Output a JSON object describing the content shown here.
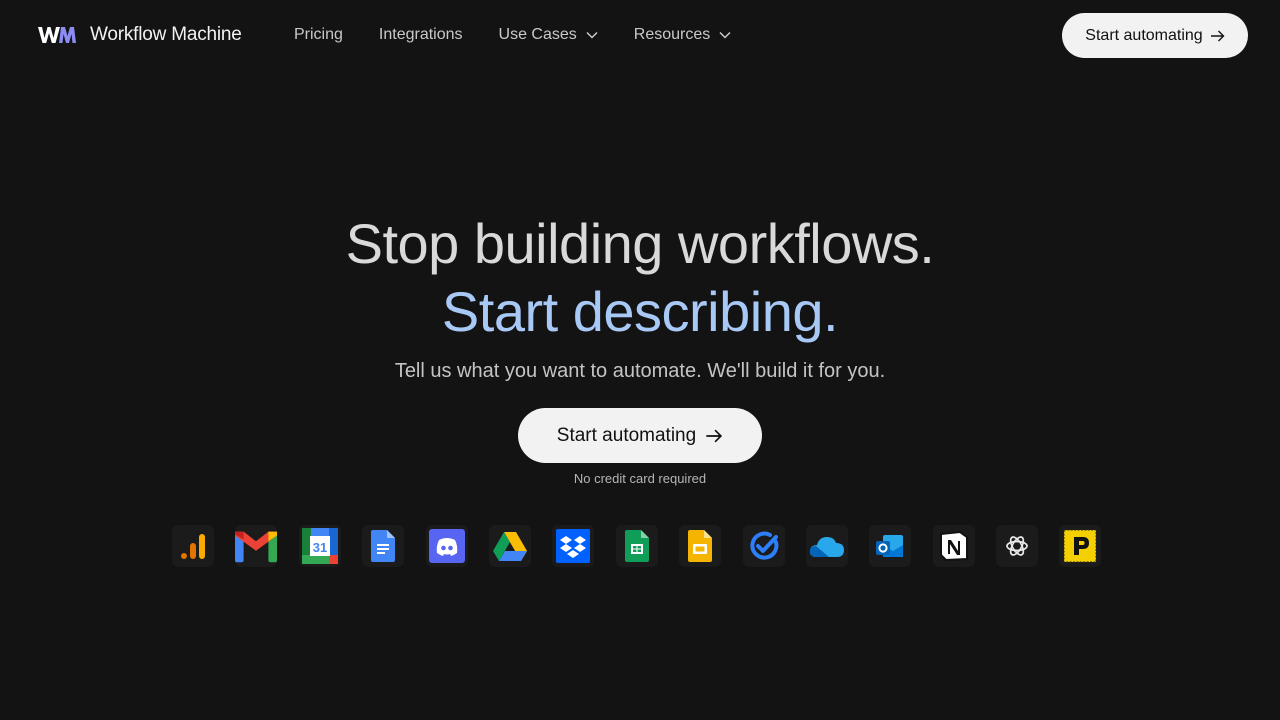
{
  "brand": {
    "name": "Workflow Machine",
    "logo_icon": "wm-logo-icon"
  },
  "nav": {
    "links": [
      {
        "label": "Pricing",
        "has_dropdown": false
      },
      {
        "label": "Integrations",
        "has_dropdown": false
      },
      {
        "label": "Use Cases",
        "has_dropdown": true
      },
      {
        "label": "Resources",
        "has_dropdown": true
      }
    ],
    "cta_label": "Start automating"
  },
  "hero": {
    "title_line1": "Stop building workflows.",
    "title_line2": "Start describing.",
    "subtitle": "Tell us what you want to automate. We'll build it for you.",
    "cta_label": "Start automating",
    "note": "No credit card required"
  },
  "integrations": [
    "google-analytics-icon",
    "gmail-icon",
    "google-calendar-icon",
    "google-docs-icon",
    "discord-icon",
    "google-drive-icon",
    "dropbox-icon",
    "google-sheets-icon",
    "google-slides-icon",
    "check-circle-icon",
    "onedrive-icon",
    "outlook-icon",
    "notion-icon",
    "openai-icon",
    "producthunt-icon"
  ],
  "calendar_day": "31",
  "colors": {
    "background": "#131313",
    "accent_title": "#a8c8f5",
    "button_bg": "#f2f2f2"
  }
}
